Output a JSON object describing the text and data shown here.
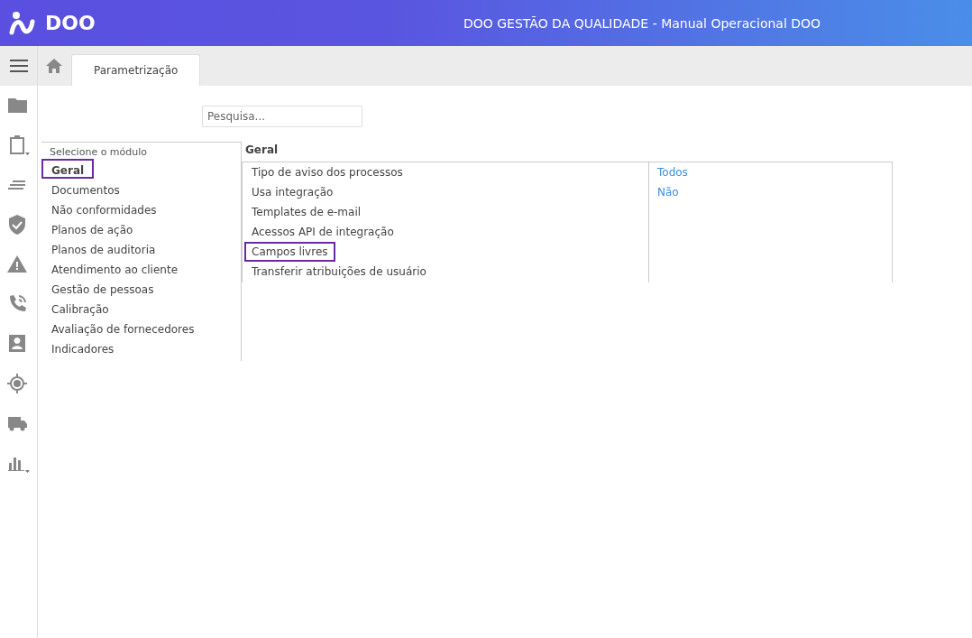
{
  "header": {
    "logo_text": "DOO",
    "title": "DOO GESTÃO DA QUALIDADE - Manual Operacional DOO"
  },
  "sidebar_icons": [
    {
      "kind": "folder",
      "dropdown": false
    },
    {
      "kind": "clipboard",
      "dropdown": true
    },
    {
      "kind": "lines",
      "dropdown": false
    },
    {
      "kind": "shield",
      "dropdown": false
    },
    {
      "kind": "warning",
      "dropdown": false
    },
    {
      "kind": "phone",
      "dropdown": false
    },
    {
      "kind": "contact",
      "dropdown": false
    },
    {
      "kind": "target",
      "dropdown": false
    },
    {
      "kind": "truck",
      "dropdown": false
    },
    {
      "kind": "chart",
      "dropdown": true
    }
  ],
  "tabs": [
    {
      "label": "Parametrização",
      "selected": true
    }
  ],
  "search": {
    "placeholder": "Pesquisa..."
  },
  "modules": {
    "heading": "Selecione o módulo",
    "items": [
      {
        "label": "Geral",
        "selected": true,
        "highlighted": true
      },
      {
        "label": "Documentos",
        "selected": false,
        "highlighted": false
      },
      {
        "label": "Não conformidades",
        "selected": false,
        "highlighted": false
      },
      {
        "label": "Planos de ação",
        "selected": false,
        "highlighted": false
      },
      {
        "label": "Planos de auditoria",
        "selected": false,
        "highlighted": false
      },
      {
        "label": "Atendimento ao cliente",
        "selected": false,
        "highlighted": false
      },
      {
        "label": "Gestão de pessoas",
        "selected": false,
        "highlighted": false
      },
      {
        "label": "Calibração",
        "selected": false,
        "highlighted": false
      },
      {
        "label": "Avaliação de fornecedores",
        "selected": false,
        "highlighted": false
      },
      {
        "label": "Indicadores",
        "selected": false,
        "highlighted": false
      }
    ]
  },
  "settings": {
    "title": "Geral",
    "rows": [
      {
        "label": "Tipo de aviso dos processos",
        "value": "Todos",
        "highlighted": false
      },
      {
        "label": "Usa integração",
        "value": "Não",
        "highlighted": false
      },
      {
        "label": "Templates de e-mail",
        "highlighted": false
      },
      {
        "label": "Acessos API de integração",
        "highlighted": false
      },
      {
        "label": "Campos livres",
        "highlighted": true
      },
      {
        "label": "Transferir atribuições de usuário",
        "highlighted": false
      }
    ]
  }
}
